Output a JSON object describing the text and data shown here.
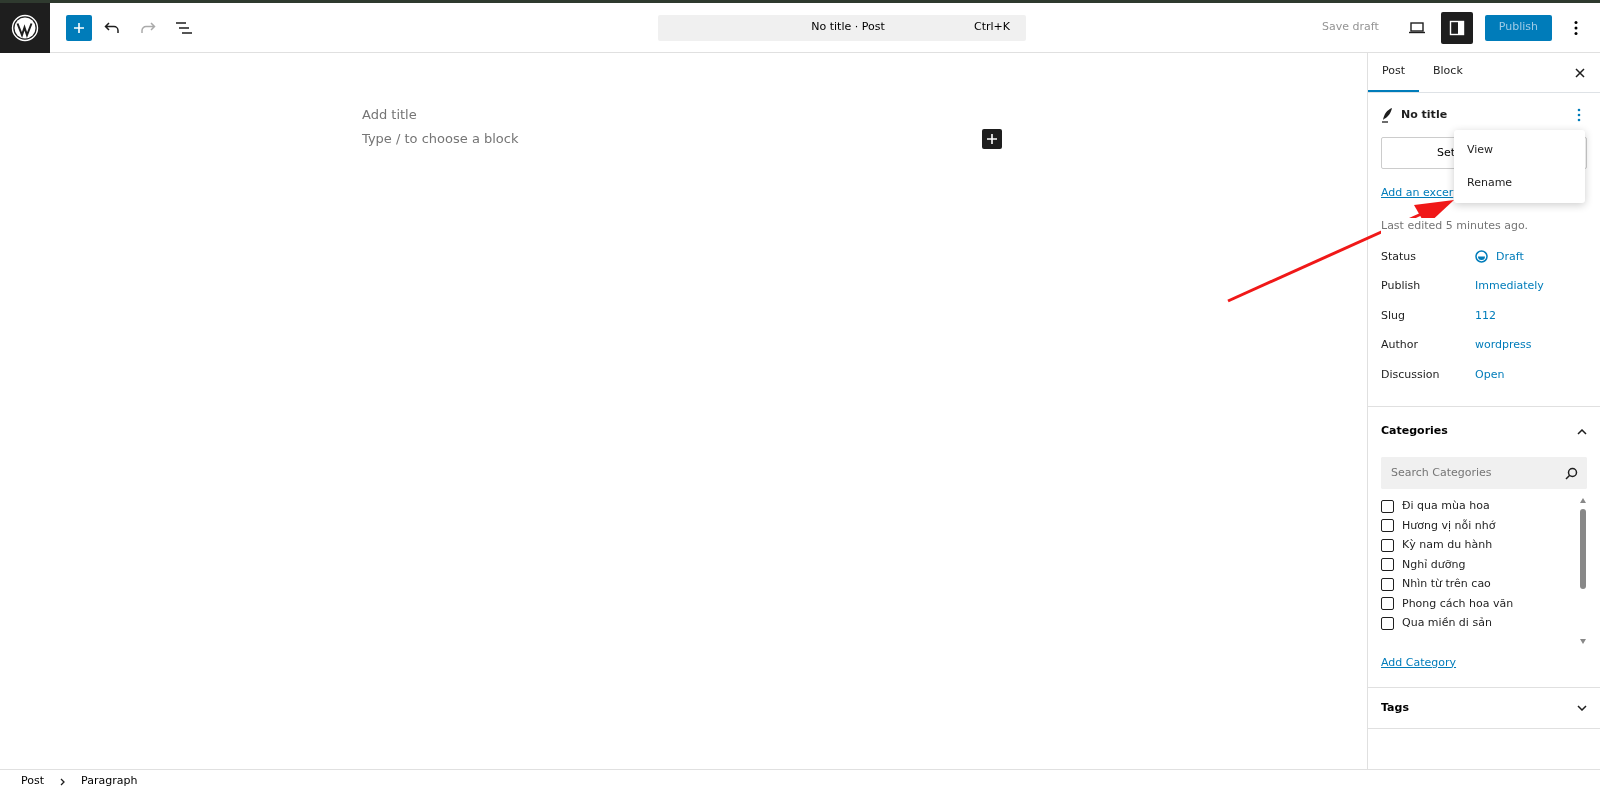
{
  "top_bar": {
    "command_bar": {
      "title": "No title · Post",
      "shortcut": "Ctrl+K"
    },
    "save_draft": {
      "label": "Save draft",
      "disabled": true
    },
    "publish": {
      "label": "Publish",
      "disabled": true
    },
    "settings_toggle": {
      "on": true
    }
  },
  "editor": {
    "title_placeholder": "Add title",
    "block_placeholder": "Type / to choose a block"
  },
  "sidebar": {
    "tabs": [
      {
        "label": "Post",
        "selected": true
      },
      {
        "label": "Block",
        "selected": false
      }
    ],
    "post_title": "No title",
    "featured_button": "Set",
    "excerpt_link": "Add an excer",
    "last_edited": "Last edited 5 minutes ago.",
    "menu": [
      {
        "label": "View"
      },
      {
        "label": "Rename"
      }
    ],
    "fields": [
      {
        "label": "Status",
        "value": "Draft",
        "kind": "status"
      },
      {
        "label": "Publish",
        "value": "Immediately",
        "kind": "link"
      },
      {
        "label": "Slug",
        "value": "112",
        "kind": "link"
      },
      {
        "label": "Author",
        "value": "wordpress",
        "kind": "link"
      },
      {
        "label": "Discussion",
        "value": "Open",
        "kind": "link"
      }
    ],
    "categories": {
      "title": "Categories",
      "expanded": true,
      "search_placeholder": "Search Categories",
      "items": [
        {
          "label": "Đi qua mùa hoa",
          "checked": false
        },
        {
          "label": "Hương vị nỗi nhớ",
          "checked": false
        },
        {
          "label": "Kỳ nam du hành",
          "checked": false
        },
        {
          "label": "Nghỉ dưỡng",
          "checked": false
        },
        {
          "label": "Nhìn từ trên cao",
          "checked": false
        },
        {
          "label": "Phong cách hoa văn",
          "checked": false
        },
        {
          "label": "Qua miền di sản",
          "checked": false
        }
      ],
      "add_link": "Add Category"
    },
    "tags": {
      "title": "Tags",
      "expanded": false
    }
  },
  "breadcrumb": [
    "Post",
    "Paragraph"
  ]
}
